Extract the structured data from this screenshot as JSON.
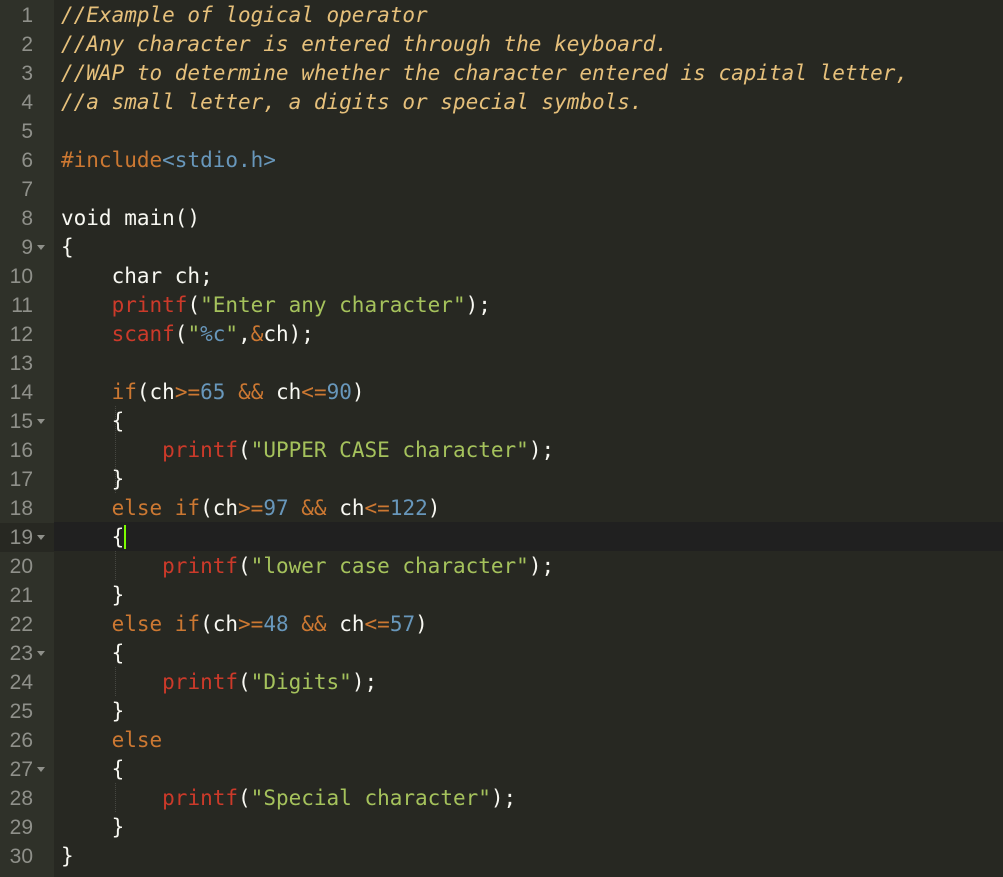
{
  "editor": {
    "active_line": 19,
    "cursor_color": "#7cfc00",
    "colors": {
      "background": "#272822",
      "gutter": "#2f3129",
      "comment": "#e6c07b",
      "keyword": "#cc7832",
      "function": "#cc3a2a",
      "string": "#a5c25c",
      "number": "#6897bb",
      "text": "#f8f8f2"
    },
    "fold_lines": [
      9,
      15,
      19,
      23,
      27
    ],
    "lines": [
      {
        "n": "1",
        "tokens": [
          [
            "t-comment",
            "//Example of logical operator"
          ]
        ]
      },
      {
        "n": "2",
        "tokens": [
          [
            "t-comment",
            "//Any character is entered through the keyboard."
          ]
        ]
      },
      {
        "n": "3",
        "tokens": [
          [
            "t-comment",
            "//WAP to determine whether the character entered is capital letter,"
          ]
        ]
      },
      {
        "n": "4",
        "tokens": [
          [
            "t-comment",
            "//a small letter, a digits or special symbols."
          ]
        ]
      },
      {
        "n": "5",
        "tokens": []
      },
      {
        "n": "6",
        "tokens": [
          [
            "t-pre",
            "#include"
          ],
          [
            "t-header",
            "<stdio.h>"
          ]
        ]
      },
      {
        "n": "7",
        "tokens": []
      },
      {
        "n": "8",
        "tokens": [
          [
            "t-plain",
            "void main()"
          ]
        ]
      },
      {
        "n": "9",
        "tokens": [
          [
            "t-plain",
            "{"
          ]
        ]
      },
      {
        "n": "10",
        "tokens": [
          [
            "t-plain",
            "    char ch;"
          ]
        ]
      },
      {
        "n": "11",
        "tokens": [
          [
            "t-plain",
            "    "
          ],
          [
            "t-func",
            "printf"
          ],
          [
            "t-plain",
            "("
          ],
          [
            "t-string",
            "\"Enter any character\""
          ],
          [
            "t-plain",
            ");"
          ]
        ]
      },
      {
        "n": "12",
        "tokens": [
          [
            "t-plain",
            "    "
          ],
          [
            "t-func",
            "scanf"
          ],
          [
            "t-plain",
            "("
          ],
          [
            "t-string",
            "\""
          ],
          [
            "t-number",
            "%c"
          ],
          [
            "t-string",
            "\""
          ],
          [
            "t-plain",
            ","
          ],
          [
            "t-amp",
            "&"
          ],
          [
            "t-plain",
            "ch);"
          ]
        ]
      },
      {
        "n": "13",
        "tokens": []
      },
      {
        "n": "14",
        "tokens": [
          [
            "t-plain",
            "    "
          ],
          [
            "t-keyword",
            "if"
          ],
          [
            "t-plain",
            "(ch"
          ],
          [
            "t-op",
            ">="
          ],
          [
            "t-number",
            "65"
          ],
          [
            "t-plain",
            " "
          ],
          [
            "t-op",
            "&&"
          ],
          [
            "t-plain",
            " ch"
          ],
          [
            "t-op",
            "<="
          ],
          [
            "t-number",
            "90"
          ],
          [
            "t-plain",
            ")"
          ]
        ]
      },
      {
        "n": "15",
        "tokens": [
          [
            "t-plain",
            "    {"
          ]
        ]
      },
      {
        "n": "16",
        "tokens": [
          [
            "t-plain",
            "        "
          ],
          [
            "t-func",
            "printf"
          ],
          [
            "t-plain",
            "("
          ],
          [
            "t-string",
            "\"UPPER CASE character\""
          ],
          [
            "t-plain",
            ");"
          ]
        ]
      },
      {
        "n": "17",
        "tokens": [
          [
            "t-plain",
            "    }"
          ]
        ]
      },
      {
        "n": "18",
        "tokens": [
          [
            "t-plain",
            "    "
          ],
          [
            "t-keyword",
            "else if"
          ],
          [
            "t-plain",
            "(ch"
          ],
          [
            "t-op",
            ">="
          ],
          [
            "t-number",
            "97"
          ],
          [
            "t-plain",
            " "
          ],
          [
            "t-op",
            "&&"
          ],
          [
            "t-plain",
            " ch"
          ],
          [
            "t-op",
            "<="
          ],
          [
            "t-number",
            "122"
          ],
          [
            "t-plain",
            ")"
          ]
        ]
      },
      {
        "n": "19",
        "tokens": [
          [
            "t-plain",
            "    {"
          ]
        ],
        "cursor": true
      },
      {
        "n": "20",
        "tokens": [
          [
            "t-plain",
            "        "
          ],
          [
            "t-func",
            "printf"
          ],
          [
            "t-plain",
            "("
          ],
          [
            "t-string",
            "\"lower case character\""
          ],
          [
            "t-plain",
            ");"
          ]
        ]
      },
      {
        "n": "21",
        "tokens": [
          [
            "t-plain",
            "    }"
          ]
        ]
      },
      {
        "n": "22",
        "tokens": [
          [
            "t-plain",
            "    "
          ],
          [
            "t-keyword",
            "else if"
          ],
          [
            "t-plain",
            "(ch"
          ],
          [
            "t-op",
            ">="
          ],
          [
            "t-number",
            "48"
          ],
          [
            "t-plain",
            " "
          ],
          [
            "t-op",
            "&&"
          ],
          [
            "t-plain",
            " ch"
          ],
          [
            "t-op",
            "<="
          ],
          [
            "t-number",
            "57"
          ],
          [
            "t-plain",
            ")"
          ]
        ]
      },
      {
        "n": "23",
        "tokens": [
          [
            "t-plain",
            "    {"
          ]
        ]
      },
      {
        "n": "24",
        "tokens": [
          [
            "t-plain",
            "        "
          ],
          [
            "t-func",
            "printf"
          ],
          [
            "t-plain",
            "("
          ],
          [
            "t-string",
            "\"Digits\""
          ],
          [
            "t-plain",
            ");"
          ]
        ]
      },
      {
        "n": "25",
        "tokens": [
          [
            "t-plain",
            "    }"
          ]
        ]
      },
      {
        "n": "26",
        "tokens": [
          [
            "t-plain",
            "    "
          ],
          [
            "t-keyword",
            "else"
          ]
        ]
      },
      {
        "n": "27",
        "tokens": [
          [
            "t-plain",
            "    {"
          ]
        ]
      },
      {
        "n": "28",
        "tokens": [
          [
            "t-plain",
            "        "
          ],
          [
            "t-func",
            "printf"
          ],
          [
            "t-plain",
            "("
          ],
          [
            "t-string",
            "\"Special character\""
          ],
          [
            "t-plain",
            ");"
          ]
        ]
      },
      {
        "n": "29",
        "tokens": [
          [
            "t-plain",
            "    }"
          ]
        ]
      },
      {
        "n": "30",
        "tokens": [
          [
            "t-plain",
            "}"
          ]
        ]
      }
    ]
  }
}
